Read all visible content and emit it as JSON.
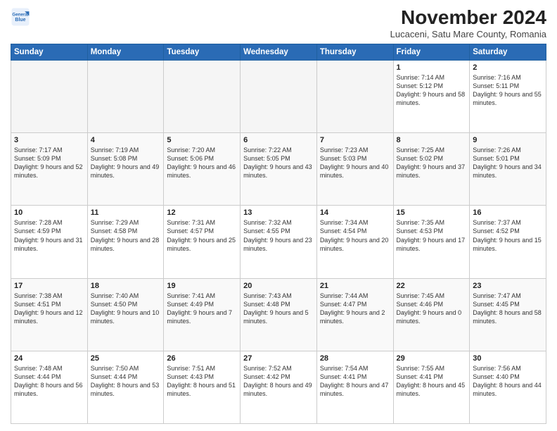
{
  "logo": {
    "line1": "General",
    "line2": "Blue"
  },
  "header": {
    "title": "November 2024",
    "location": "Lucaceni, Satu Mare County, Romania"
  },
  "weekdays": [
    "Sunday",
    "Monday",
    "Tuesday",
    "Wednesday",
    "Thursday",
    "Friday",
    "Saturday"
  ],
  "weeks": [
    [
      {
        "day": "",
        "info": ""
      },
      {
        "day": "",
        "info": ""
      },
      {
        "day": "",
        "info": ""
      },
      {
        "day": "",
        "info": ""
      },
      {
        "day": "",
        "info": ""
      },
      {
        "day": "1",
        "info": "Sunrise: 7:14 AM\nSunset: 5:12 PM\nDaylight: 9 hours and 58 minutes."
      },
      {
        "day": "2",
        "info": "Sunrise: 7:16 AM\nSunset: 5:11 PM\nDaylight: 9 hours and 55 minutes."
      }
    ],
    [
      {
        "day": "3",
        "info": "Sunrise: 7:17 AM\nSunset: 5:09 PM\nDaylight: 9 hours and 52 minutes."
      },
      {
        "day": "4",
        "info": "Sunrise: 7:19 AM\nSunset: 5:08 PM\nDaylight: 9 hours and 49 minutes."
      },
      {
        "day": "5",
        "info": "Sunrise: 7:20 AM\nSunset: 5:06 PM\nDaylight: 9 hours and 46 minutes."
      },
      {
        "day": "6",
        "info": "Sunrise: 7:22 AM\nSunset: 5:05 PM\nDaylight: 9 hours and 43 minutes."
      },
      {
        "day": "7",
        "info": "Sunrise: 7:23 AM\nSunset: 5:03 PM\nDaylight: 9 hours and 40 minutes."
      },
      {
        "day": "8",
        "info": "Sunrise: 7:25 AM\nSunset: 5:02 PM\nDaylight: 9 hours and 37 minutes."
      },
      {
        "day": "9",
        "info": "Sunrise: 7:26 AM\nSunset: 5:01 PM\nDaylight: 9 hours and 34 minutes."
      }
    ],
    [
      {
        "day": "10",
        "info": "Sunrise: 7:28 AM\nSunset: 4:59 PM\nDaylight: 9 hours and 31 minutes."
      },
      {
        "day": "11",
        "info": "Sunrise: 7:29 AM\nSunset: 4:58 PM\nDaylight: 9 hours and 28 minutes."
      },
      {
        "day": "12",
        "info": "Sunrise: 7:31 AM\nSunset: 4:57 PM\nDaylight: 9 hours and 25 minutes."
      },
      {
        "day": "13",
        "info": "Sunrise: 7:32 AM\nSunset: 4:55 PM\nDaylight: 9 hours and 23 minutes."
      },
      {
        "day": "14",
        "info": "Sunrise: 7:34 AM\nSunset: 4:54 PM\nDaylight: 9 hours and 20 minutes."
      },
      {
        "day": "15",
        "info": "Sunrise: 7:35 AM\nSunset: 4:53 PM\nDaylight: 9 hours and 17 minutes."
      },
      {
        "day": "16",
        "info": "Sunrise: 7:37 AM\nSunset: 4:52 PM\nDaylight: 9 hours and 15 minutes."
      }
    ],
    [
      {
        "day": "17",
        "info": "Sunrise: 7:38 AM\nSunset: 4:51 PM\nDaylight: 9 hours and 12 minutes."
      },
      {
        "day": "18",
        "info": "Sunrise: 7:40 AM\nSunset: 4:50 PM\nDaylight: 9 hours and 10 minutes."
      },
      {
        "day": "19",
        "info": "Sunrise: 7:41 AM\nSunset: 4:49 PM\nDaylight: 9 hours and 7 minutes."
      },
      {
        "day": "20",
        "info": "Sunrise: 7:43 AM\nSunset: 4:48 PM\nDaylight: 9 hours and 5 minutes."
      },
      {
        "day": "21",
        "info": "Sunrise: 7:44 AM\nSunset: 4:47 PM\nDaylight: 9 hours and 2 minutes."
      },
      {
        "day": "22",
        "info": "Sunrise: 7:45 AM\nSunset: 4:46 PM\nDaylight: 9 hours and 0 minutes."
      },
      {
        "day": "23",
        "info": "Sunrise: 7:47 AM\nSunset: 4:45 PM\nDaylight: 8 hours and 58 minutes."
      }
    ],
    [
      {
        "day": "24",
        "info": "Sunrise: 7:48 AM\nSunset: 4:44 PM\nDaylight: 8 hours and 56 minutes."
      },
      {
        "day": "25",
        "info": "Sunrise: 7:50 AM\nSunset: 4:44 PM\nDaylight: 8 hours and 53 minutes."
      },
      {
        "day": "26",
        "info": "Sunrise: 7:51 AM\nSunset: 4:43 PM\nDaylight: 8 hours and 51 minutes."
      },
      {
        "day": "27",
        "info": "Sunrise: 7:52 AM\nSunset: 4:42 PM\nDaylight: 8 hours and 49 minutes."
      },
      {
        "day": "28",
        "info": "Sunrise: 7:54 AM\nSunset: 4:41 PM\nDaylight: 8 hours and 47 minutes."
      },
      {
        "day": "29",
        "info": "Sunrise: 7:55 AM\nSunset: 4:41 PM\nDaylight: 8 hours and 45 minutes."
      },
      {
        "day": "30",
        "info": "Sunrise: 7:56 AM\nSunset: 4:40 PM\nDaylight: 8 hours and 44 minutes."
      }
    ]
  ]
}
